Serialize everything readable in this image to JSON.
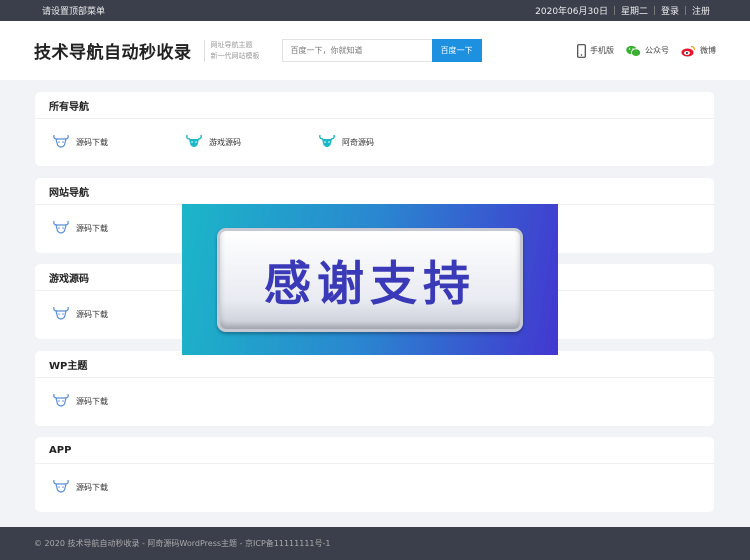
{
  "topbar": {
    "menu_label": "请设置顶部菜单",
    "date": "2020年06月30日",
    "weekday": "星期二",
    "login": "登录",
    "register": "注册"
  },
  "header": {
    "logo": "技术导航自动秒收录",
    "tagline_1": "网址导航主题",
    "tagline_2": "新一代网站模板",
    "search_placeholder": "百度一下，你就知道",
    "search_button": "百度一下",
    "links": [
      {
        "label": "手机版",
        "icon": "phone-icon"
      },
      {
        "label": "公众号",
        "icon": "wechat-icon"
      },
      {
        "label": "微博",
        "icon": "weibo-icon"
      }
    ]
  },
  "sections": [
    {
      "title": "所有导航",
      "items": [
        {
          "label": "源码下载",
          "icon": "bull-outline-icon"
        },
        {
          "label": "游戏源码",
          "icon": "bull-solid-icon"
        },
        {
          "label": "阿奇源码",
          "icon": "bull-solid-icon"
        }
      ]
    },
    {
      "title": "网站导航",
      "items": [
        {
          "label": "源码下载",
          "icon": "bull-outline-icon"
        }
      ]
    },
    {
      "title": "游戏源码",
      "items": [
        {
          "label": "源码下载",
          "icon": "bull-outline-icon"
        }
      ]
    },
    {
      "title": "WP主题",
      "items": [
        {
          "label": "源码下载",
          "icon": "bull-outline-icon"
        }
      ]
    },
    {
      "title": "APP",
      "items": [
        {
          "label": "源码下载",
          "icon": "bull-outline-icon"
        }
      ]
    }
  ],
  "banner": {
    "text": "感谢支持"
  },
  "footer": {
    "text": "© 2020 技术导航自动秒收录 - 阿奇源码WordPress主题 - 京ICP备11111111号-1"
  },
  "colors": {
    "accent": "#1e90e0",
    "bull_outline": "#5a8fd8",
    "bull_solid": "#1cb8c8",
    "topbar": "#3a3f4b"
  }
}
